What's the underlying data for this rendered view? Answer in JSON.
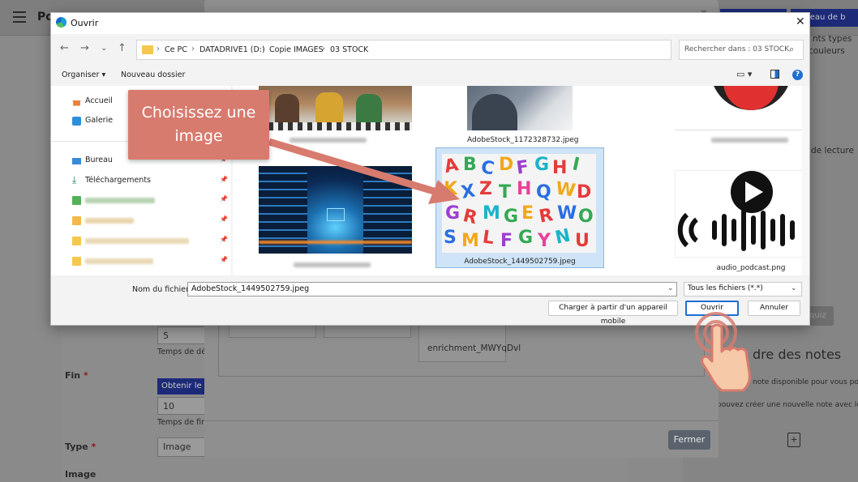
{
  "background_app": {
    "title": "Po",
    "right_snippets": [
      "nts types",
      "couleurs",
      "de lecture",
      "quiz"
    ],
    "top_button": "Tableau de b",
    "form": {
      "field_value_1": "5",
      "helper_1": "Temps de dé",
      "fin_label": "Fin",
      "required_mark": "*",
      "obtenir_button": "Obtenir le t",
      "field_value_2": "10",
      "helper_2": "Temps de fin",
      "type_label": "Type",
      "type_value": "Image",
      "image_label": "Image"
    },
    "notes": {
      "heading": "dre des notes",
      "line1": "note disponible pour vous pour",
      "line2": "pouvez créer une nouvelle note avec le b"
    }
  },
  "middle_modal": {
    "card_label": "enrichment_MWYqDvl",
    "close_button": "Fermer"
  },
  "dialog": {
    "title": "Ouvrir",
    "breadcrumb": [
      "Ce PC",
      "DATADRIVE1 (D:)",
      "Copie IMAGES",
      "03 STOCK"
    ],
    "search_placeholder": "Rechercher dans : 03 STOCK",
    "toolbar": {
      "organiser": "Organiser ▾",
      "new_folder": "Nouveau dossier"
    },
    "sidebar": [
      {
        "label": "Accueil",
        "icon": "home-icon"
      },
      {
        "label": "Galerie",
        "icon": "gallery-icon"
      },
      {
        "label": "Bureau",
        "icon": "desktop-icon"
      },
      {
        "label": "Téléchargements",
        "icon": "download-icon"
      }
    ],
    "files": {
      "file_1": "AdobeStock_1172328732.jpeg",
      "file_2": "AdobeStock_1449502759.jpeg",
      "file_3": "audio_podcast.png"
    },
    "filename_label": "Nom du fichier :",
    "filename_value": "AdobeStock_1449502759.jpeg",
    "filetype_value": "Tous les fichiers (*.*)",
    "mobile_button": "Charger à partir d'un appareil mobile",
    "open_button": "Ouvrir",
    "cancel_button": "Annuler"
  },
  "callout": {
    "line1": "Choisissez une",
    "line2": "image"
  },
  "colors": {
    "accent": "#1e6fd1",
    "callout": "#d77b6e",
    "selection": "#cfe4f7"
  }
}
